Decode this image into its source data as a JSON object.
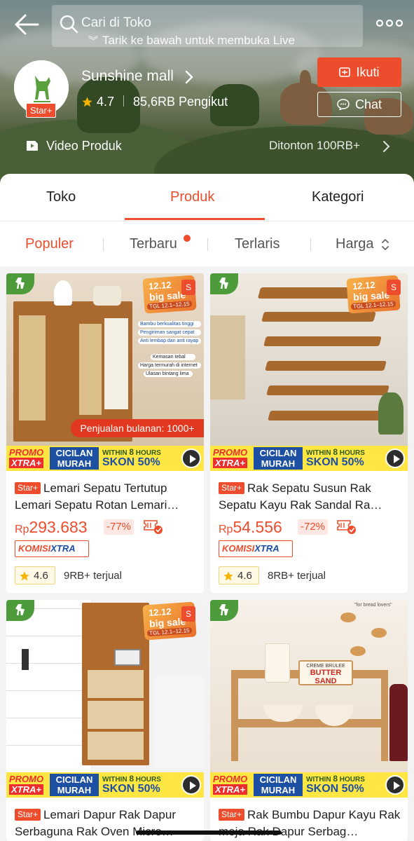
{
  "header": {
    "search_placeholder": "Cari di Toko",
    "pull_hint": "Tarik ke bawah untuk membuka Live",
    "shop": {
      "name": "Sunshine mall",
      "badge": "Star+",
      "rating": "4.7",
      "followers": "85,6RB Pengikut"
    },
    "follow_label": "Ikuti",
    "chat_label": "Chat",
    "video_label": "Video Produk",
    "watched": "Ditonton 100RB+"
  },
  "tabs": [
    {
      "label": "Toko",
      "active": false
    },
    {
      "label": "Produk",
      "active": true
    },
    {
      "label": "Kategori",
      "active": false
    }
  ],
  "sort": [
    {
      "label": "Populer",
      "active": true
    },
    {
      "label": "Terbaru",
      "active": false
    },
    {
      "label": "Terlaris",
      "active": false
    },
    {
      "label": "Harga",
      "active": false
    }
  ],
  "colors": {
    "accent": "#ee4d2d",
    "rating_star": "#f5b400"
  },
  "promo": {
    "xtra_line1": "PROMO",
    "xtra_line2": "XTRA+",
    "cicilan_line1": "CICILAN",
    "cicilan_line2": "MURAH",
    "within": "WITHIN",
    "within_num": "8",
    "within_unit": "HOURS",
    "diskon": "SKON 50%"
  },
  "sale_badge": {
    "line1": "12.12",
    "line2": "big sale",
    "line3": "TGL 12.1–12.15"
  },
  "products": [
    {
      "badge": "Star+",
      "name": "Lemari Sepatu Tertutup Lemari Sepatu Rotan Lemari…",
      "currency": "Rp",
      "price": "293.683",
      "discount": "-77%",
      "komisi_1": "KOMISI",
      "komisi_2": "XTRA",
      "rating": "4.6",
      "sold": "9RB+ terjual",
      "img_overlay": {
        "features": [
          "Bambu berkualitas tinggi",
          "Pengiriman sangat cepat",
          "Anti lembap dan anti rayap",
          "Kemasan tebal",
          "Harga termurah di internet",
          "Ulasan bintang lima"
        ],
        "monthly": "Penjualan bulanan: 1000+"
      }
    },
    {
      "badge": "Star+",
      "name": "Rak Sepatu Susun Rak Sepatu Kayu Rak Sandal Ra…",
      "currency": "Rp",
      "price": "54.556",
      "discount": "-72%",
      "komisi_1": "KOMISI",
      "komisi_2": "XTRA",
      "rating": "4.6",
      "sold": "8RB+ terjual"
    },
    {
      "badge": "Star+",
      "name": "Lemari Dapur Rak Dapur Serbaguna Rak Oven Micro…"
    },
    {
      "badge": "Star+",
      "name": "Rak Bumbu Dapur Kayu Rak meja Rak Dapur Serbag…",
      "img_overlay": {
        "note": "\"for bread lovers\"",
        "sign_1": "CREME BRULEE",
        "sign_2": "BUTTER SAND"
      }
    }
  ]
}
